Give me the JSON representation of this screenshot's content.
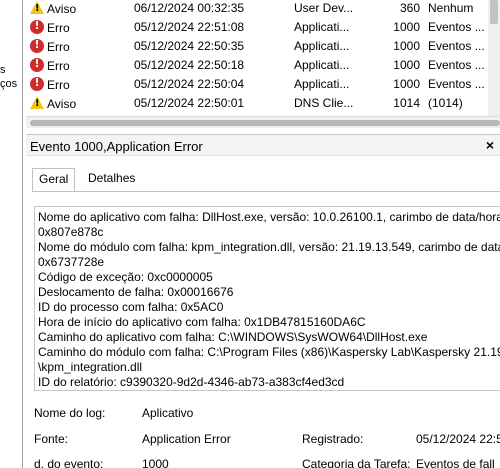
{
  "left_panel": {
    "line1": "s",
    "line2": "ços"
  },
  "events": [
    {
      "level": "Aviso",
      "level_type": "warning",
      "date": "06/12/2024 00:32:35",
      "source": "User Dev...",
      "id": "360",
      "category": "Nenhum"
    },
    {
      "level": "Erro",
      "level_type": "error",
      "date": "05/12/2024 22:51:08",
      "source": "Applicati...",
      "id": "1000",
      "category": "Eventos ..."
    },
    {
      "level": "Erro",
      "level_type": "error",
      "date": "05/12/2024 22:50:35",
      "source": "Applicati...",
      "id": "1000",
      "category": "Eventos ..."
    },
    {
      "level": "Erro",
      "level_type": "error",
      "date": "05/12/2024 22:50:18",
      "source": "Applicati...",
      "id": "1000",
      "category": "Eventos ..."
    },
    {
      "level": "Erro",
      "level_type": "error",
      "date": "05/12/2024 22:50:04",
      "source": "Applicati...",
      "id": "1000",
      "category": "Eventos ..."
    },
    {
      "level": "Aviso",
      "level_type": "warning",
      "date": "05/12/2024 22:50:01",
      "source": "DNS Clie...",
      "id": "1014",
      "category": "(1014)"
    }
  ],
  "details": {
    "title": "Evento 1000,Application Error",
    "close": "×",
    "tabs": [
      "Geral",
      "Detalhes"
    ],
    "description": [
      "Nome do aplicativo com falha: DllHost.exe, versão: 10.0.26100.1, carimbo de data/hora",
      "0x807e878c",
      "Nome do módulo com falha: kpm_integration.dll, versão: 21.19.13.549, carimbo de data",
      "0x6737728e",
      "Código de exceção: 0xc0000005",
      "Deslocamento de falha: 0x00016676",
      "ID do processo com falha: 0x5AC0",
      "Hora de início do aplicativo com falha: 0x1DB47815160DA6C",
      "Caminho do aplicativo com falha: C:\\WINDOWS\\SysWOW64\\DllHost.exe",
      "Caminho do módulo com falha: C:\\Program Files (x86)\\Kaspersky Lab\\Kaspersky 21.19",
      "\\kpm_integration.dll",
      "ID do relatório: c9390320-9d2d-4346-ab73-a383cf4ed3cd"
    ],
    "log_label": "Nome do log:",
    "log_value": "Aplicativo",
    "source_label": "Fonte:",
    "source_value": "Application Error",
    "recorded_label": "Registrado:",
    "recorded_value": "05/12/2024 22:5",
    "event_id_label": "d. do evento:",
    "event_id_value": "1000",
    "task_label": "Categoria da Tarefa:",
    "task_value": "Eventos de fall"
  }
}
